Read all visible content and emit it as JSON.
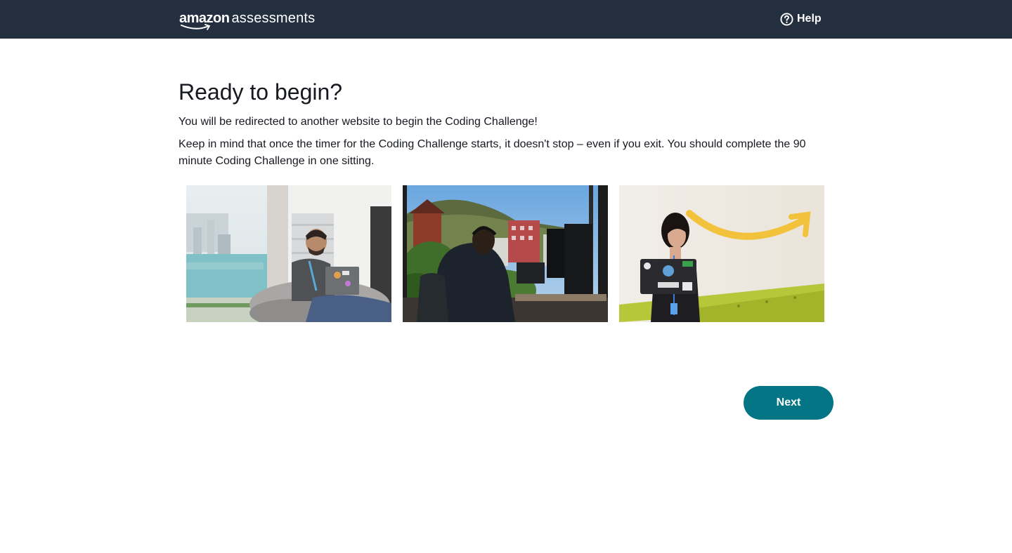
{
  "header": {
    "logo_brand": "amazon",
    "logo_product": "assessments",
    "help_label": "Help",
    "background_color": "#232f3e"
  },
  "main": {
    "title": "Ready to begin?",
    "paragraph_1": "You will be redirected to another website to begin the Coding Challenge!",
    "paragraph_2": "Keep in mind that once the timer for the Coding Challenge starts, it doesn't stop – even if you exit. You should complete the 90 minute Coding Challenge in one sitting.",
    "images": [
      {
        "name": "photo-man-laptop-window"
      },
      {
        "name": "photo-man-headset-desk"
      },
      {
        "name": "photo-woman-laptop-amazon-wall"
      }
    ],
    "next_label": "Next",
    "accent_color": "#037585"
  }
}
